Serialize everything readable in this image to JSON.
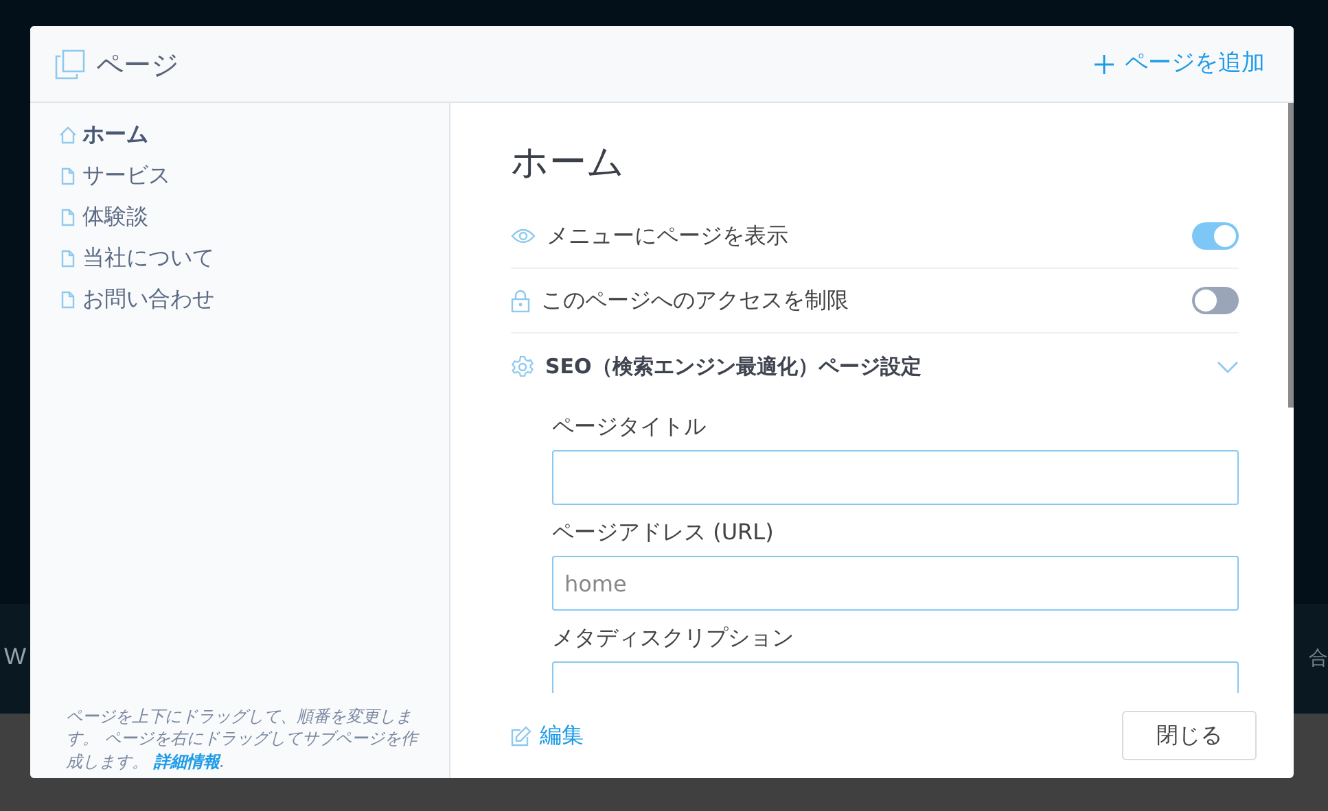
{
  "backdrop": {
    "left_text": "W",
    "right_text": "合"
  },
  "dialog": {
    "title": "ページ",
    "add_button": "ページを追加"
  },
  "sidebar": {
    "items": [
      {
        "label": "ホーム",
        "kind": "home",
        "selected": true
      },
      {
        "label": "サービス",
        "kind": "page",
        "selected": false
      },
      {
        "label": "体験談",
        "kind": "page",
        "selected": false
      },
      {
        "label": "当社について",
        "kind": "page",
        "selected": false
      },
      {
        "label": "お問い合わせ",
        "kind": "page",
        "selected": false
      }
    ],
    "hint": "ページを上下にドラッグして、順番を変更します。 ページを右にドラッグしてサブページを作成します。",
    "hint_link": "詳細情報",
    "hint_end": "."
  },
  "content": {
    "heading": "ホーム",
    "settings": [
      {
        "label": "メニューにページを表示",
        "kind": "eye",
        "on": true
      },
      {
        "label": "このページへのアクセスを制限",
        "kind": "lock",
        "on": false
      }
    ],
    "seo": {
      "label": "SEO（検索エンジン最適化）ページ設定",
      "expanded": true,
      "fields": [
        {
          "label": "ページタイトル"
        },
        {
          "label": "ページアドレス (URL)",
          "placeholder": "home"
        },
        {
          "label": "メタディスクリプション"
        }
      ]
    }
  },
  "footer": {
    "edit_link": "編集",
    "close_button": "閉じる"
  }
}
